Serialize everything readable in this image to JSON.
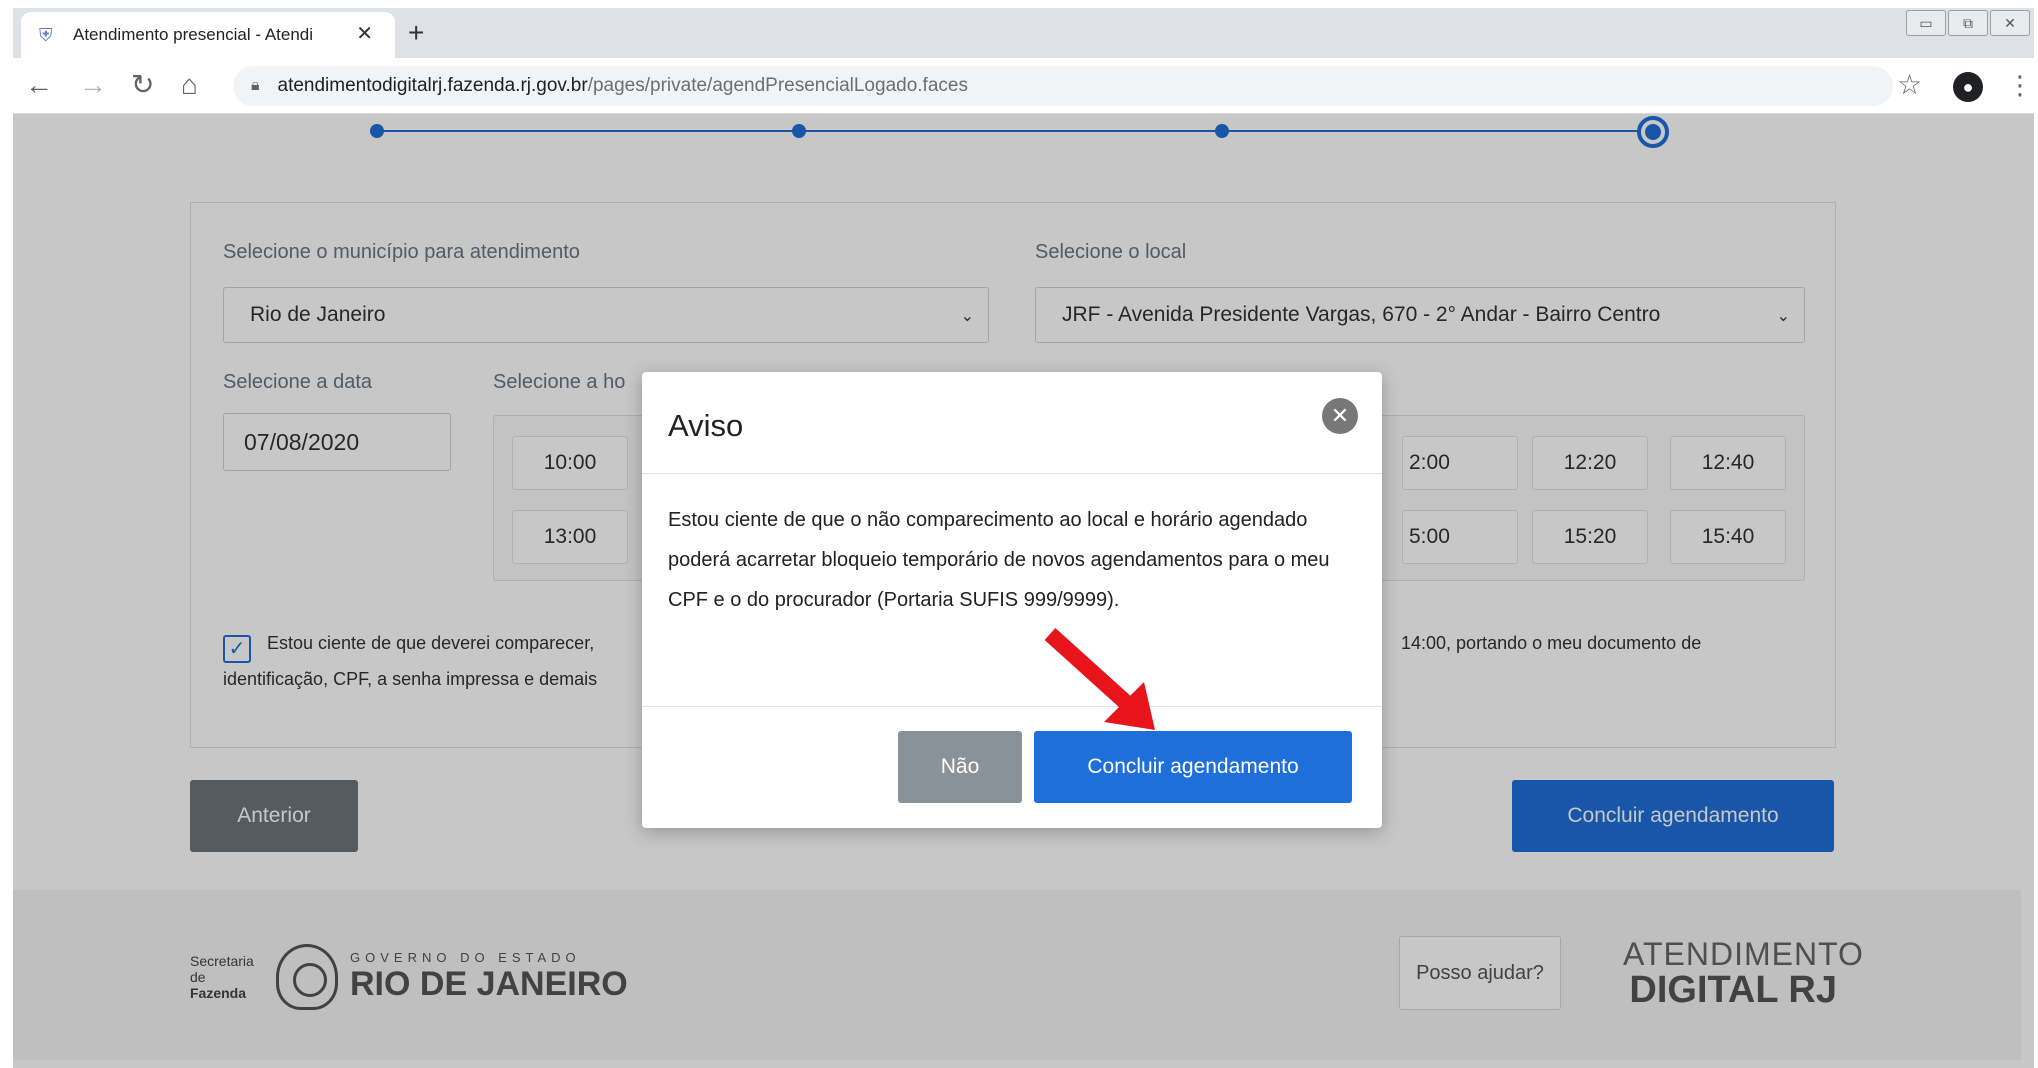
{
  "browser": {
    "tab_title": "Atendimento presencial - Atendi",
    "tab_close": "✕",
    "new_tab": "+",
    "url_host": "atendimentodigitalrj.fazenda.rj.gov.br",
    "url_path": "/pages/private/agendPresencialLogado.faces"
  },
  "form": {
    "municipio_label": "Selecione o município para atendimento",
    "municipio_value": "Rio de Janeiro",
    "local_label": "Selecione o local",
    "local_value": "JRF - Avenida Presidente Vargas, 670 - 2° Andar - Bairro Centro",
    "data_label": "Selecione a data",
    "data_value": "07/08/2020",
    "hora_label": "Selecione a ho",
    "time_slots_row1": [
      "10:00",
      "2:00",
      "12:20",
      "12:40"
    ],
    "time_slots_row2": [
      "13:00",
      "5:00",
      "15:20",
      "15:40"
    ],
    "confirm_text_left": "Estou ciente de que deverei comparecer,",
    "confirm_text_right": "14:00, portando o meu documento de",
    "confirm_text_line2": "identificação, CPF, a senha impressa e demais"
  },
  "buttons": {
    "previous": "Anterior",
    "finish": "Concluir agendamento"
  },
  "footer": {
    "secretaria_line1": "Secretaria de",
    "secretaria_line2": "Fazenda",
    "gov_small": "GOVERNO DO ESTADO",
    "gov_big": "RIO DE JANEIRO",
    "help_button": "Posso ajudar?",
    "brand_line1": "ATENDIMENTO",
    "brand_line2": "DIGITAL RJ"
  },
  "modal": {
    "title": "Aviso",
    "close_glyph": "✕",
    "message": "Estou ciente de que o não comparecimento ao local e horário agendado poderá acarretar bloqueio temporário de novos agendamentos para o meu CPF e o do procurador (Portaria SUFIS 999/9999).",
    "no_button": "Não",
    "yes_button": "Concluir agendamento"
  },
  "colors": {
    "accent": "#1e6fd9",
    "secondary": "#6c757d",
    "annotation_arrow": "#e8141b"
  },
  "icons": {
    "favicon": "coat-of-arms-icon",
    "back": "arrow-left-icon",
    "forward": "arrow-right-icon",
    "reload": "reload-icon",
    "home": "home-icon",
    "lock": "lock-icon",
    "star": "star-icon",
    "profile": "profile-icon",
    "menu": "kebab-menu-icon",
    "checkbox": "check-icon",
    "modal_close": "close-circle-icon"
  }
}
